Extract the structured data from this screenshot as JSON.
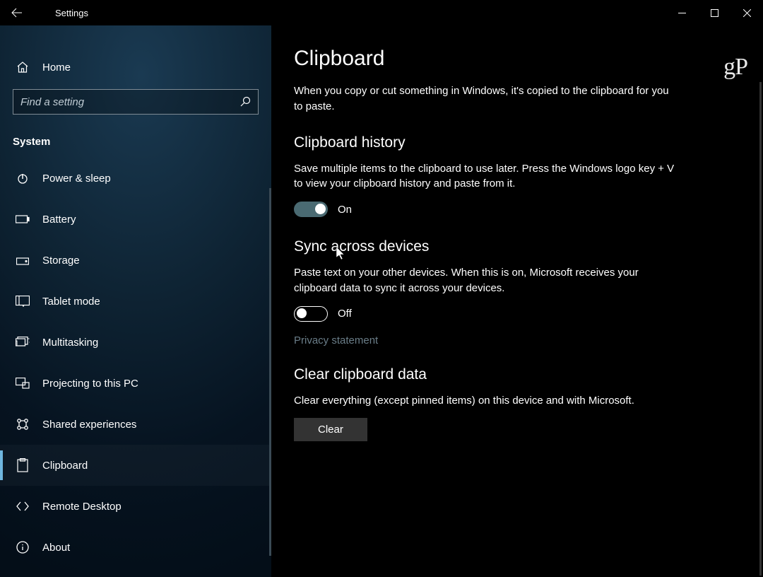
{
  "titlebar": {
    "title": "Settings"
  },
  "sidebar": {
    "home_label": "Home",
    "search_placeholder": "Find a setting",
    "category_label": "System",
    "items": [
      {
        "label": "Power & sleep",
        "icon": "power-icon"
      },
      {
        "label": "Battery",
        "icon": "battery-icon"
      },
      {
        "label": "Storage",
        "icon": "storage-icon"
      },
      {
        "label": "Tablet mode",
        "icon": "tablet-mode-icon"
      },
      {
        "label": "Multitasking",
        "icon": "multitasking-icon"
      },
      {
        "label": "Projecting to this PC",
        "icon": "projecting-icon"
      },
      {
        "label": "Shared experiences",
        "icon": "shared-experiences-icon"
      },
      {
        "label": "Clipboard",
        "icon": "clipboard-icon"
      },
      {
        "label": "Remote Desktop",
        "icon": "remote-desktop-icon"
      },
      {
        "label": "About",
        "icon": "about-icon"
      }
    ],
    "active_index": 7
  },
  "main": {
    "brand": "gP",
    "title": "Clipboard",
    "intro": "When you copy or cut something in Windows, it's copied to the clipboard for you to paste.",
    "sections": {
      "history": {
        "title": "Clipboard history",
        "desc": "Save multiple items to the clipboard to use later. Press the Windows logo key + V to view your clipboard history and paste from it.",
        "toggle_state": "On"
      },
      "sync": {
        "title": "Sync across devices",
        "desc": "Paste text on your other devices. When this is on, Microsoft receives your clipboard data to sync it across your devices.",
        "toggle_state": "Off",
        "privacy_link": "Privacy statement"
      },
      "clear": {
        "title": "Clear clipboard data",
        "desc": "Clear everything (except pinned items) on this device and with Microsoft.",
        "button_label": "Clear"
      }
    }
  }
}
